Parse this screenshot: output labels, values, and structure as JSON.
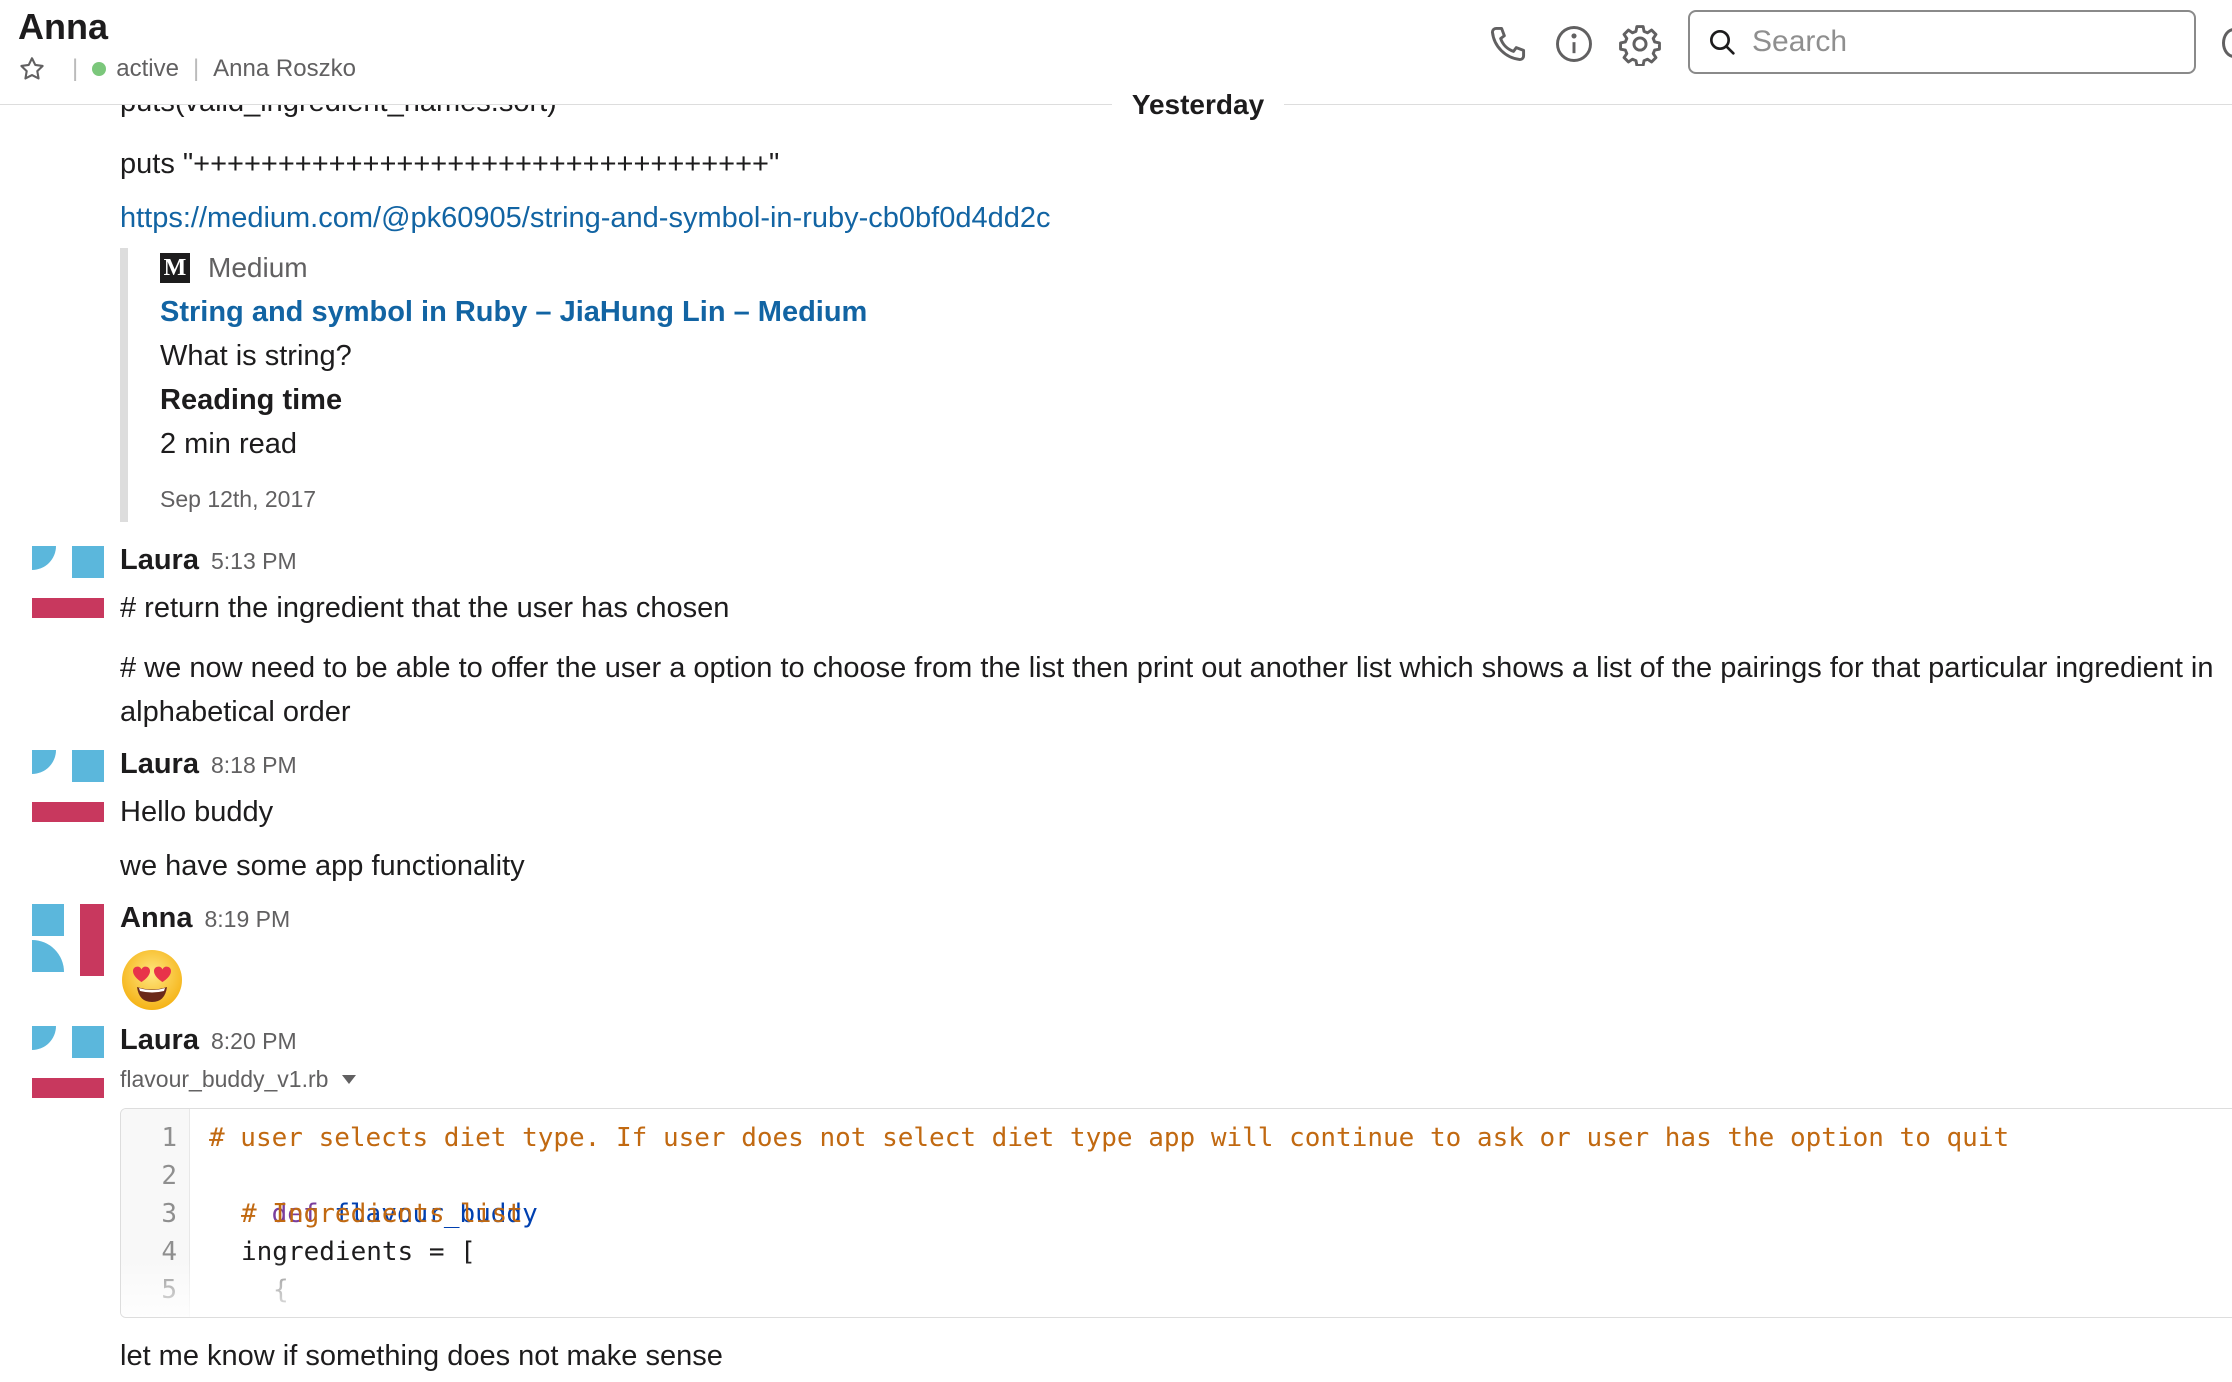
{
  "header": {
    "channel_name": "Anna",
    "status": "active",
    "full_name": "Anna Roszko",
    "search_placeholder": "Search"
  },
  "icons": {
    "star": "star-icon",
    "status_dot": "presence-dot-icon",
    "call": "phone-icon",
    "info": "info-icon",
    "settings": "gear-icon",
    "search": "search-icon"
  },
  "colors": {
    "link": "#1264a3",
    "presence": "#7bc77b",
    "avatar_blue": "#5bb7dc",
    "avatar_red": "#c8385e",
    "code_comment": "#c16911"
  },
  "divider_label": "Yesterday",
  "partial_top_line": "puts(valid_ingredient_names.sort)",
  "first_block": {
    "puts_line": "puts \"++++++++++++++++++++++++++++++++++\"",
    "link": "https://medium.com/@pk60905/string-and-symbol-in-ruby-cb0bf0d4dd2c",
    "attachment": {
      "service_logo": "M",
      "service": "Medium",
      "title": "String and symbol in Ruby – JiaHung Lin – Medium",
      "desc": "What is string?",
      "field_label": "Reading time",
      "field_value": "2 min read",
      "date": "Sep 12th, 2017"
    }
  },
  "messages": [
    {
      "author": "Laura",
      "time": "5:13 PM",
      "lines": [
        "# return the ingredient that the user has chosen",
        "# we now need to be able to offer the user a option to choose from the list then print out another list which shows a list of the pairings for that particular ingredient in",
        "alphabetical order"
      ]
    },
    {
      "author": "Laura",
      "time": "8:18 PM",
      "lines": [
        "Hello buddy",
        "we have some app functionality"
      ]
    },
    {
      "author": "Anna",
      "time": "8:19 PM",
      "emoji": "heart-eyes-emoji"
    },
    {
      "author": "Laura",
      "time": "8:20 PM",
      "file_name": "flavour_buddy_v1.rb",
      "code": {
        "line_numbers": [
          "1",
          "2",
          "3",
          "4",
          "5"
        ],
        "line1": "# user selects diet type. If user does not select diet type app will continue to ask or user has the option to quit",
        "line2_kw": "def",
        "line2_name": "flavour_buddy",
        "line3": "# Ingredients list",
        "line4": "ingredients = [",
        "line5": "{"
      },
      "after": "let me know if something does not make sense"
    }
  ]
}
